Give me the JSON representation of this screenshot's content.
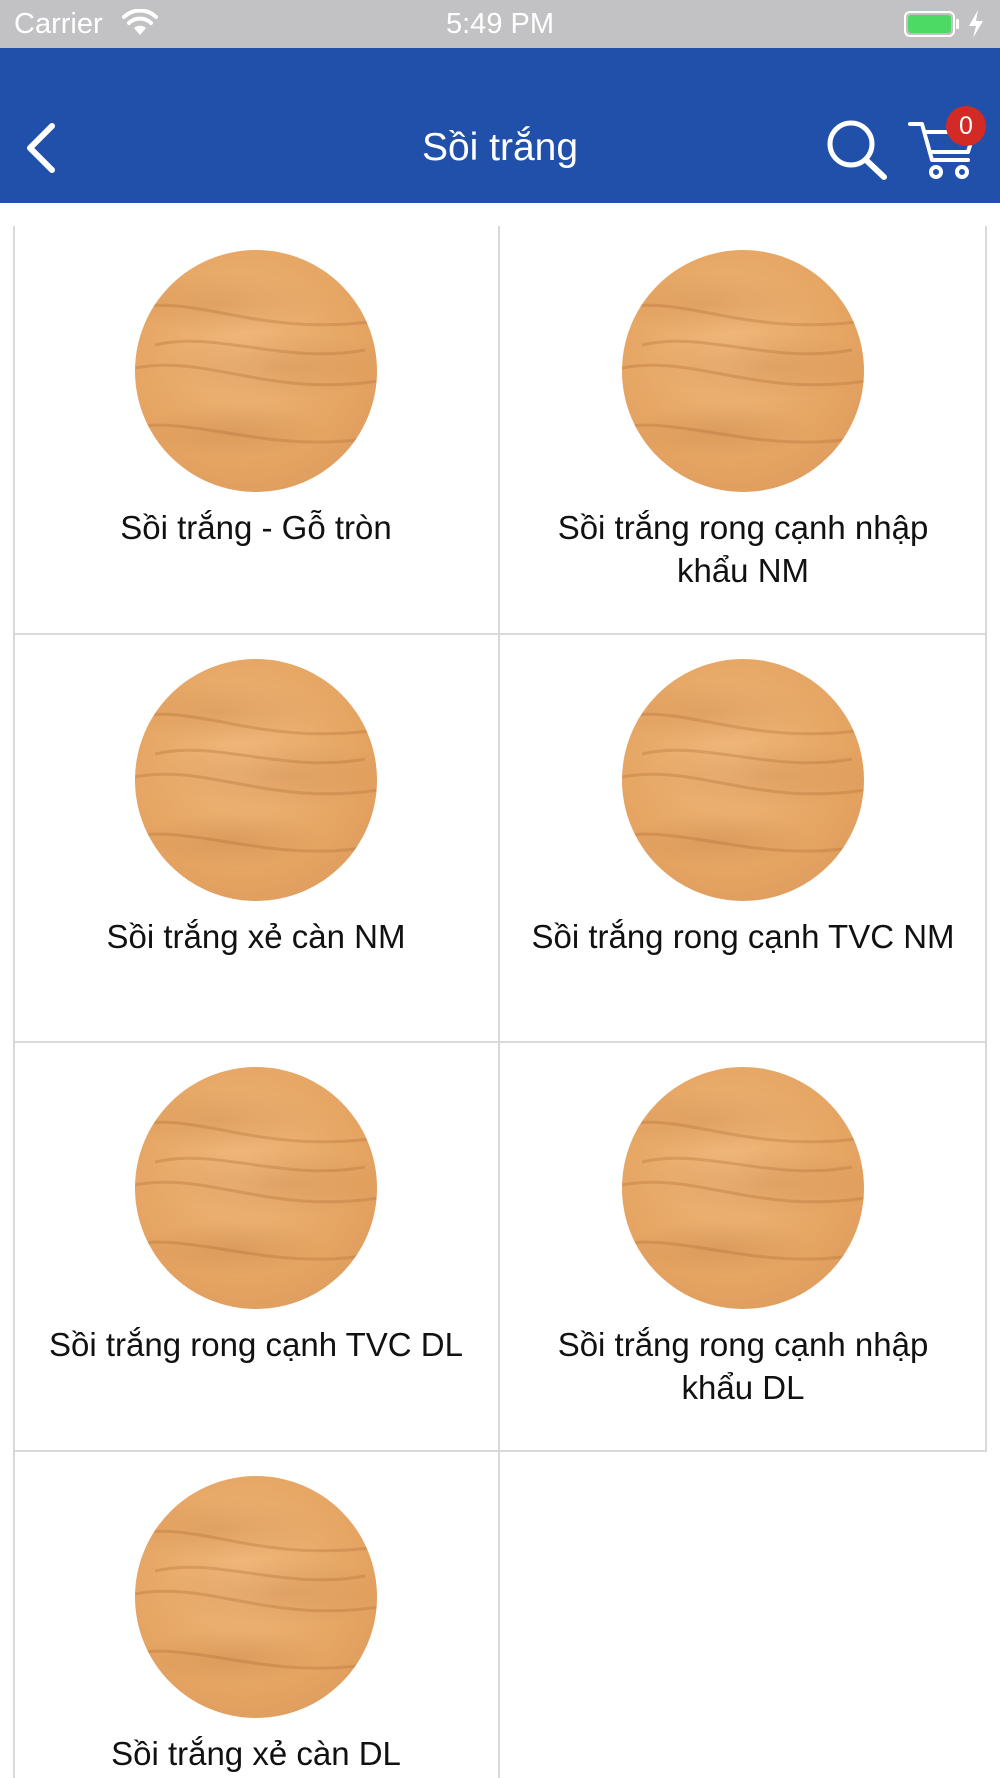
{
  "status_bar": {
    "carrier": "Carrier",
    "time": "5:49 PM",
    "battery_color": "#4cd964"
  },
  "nav": {
    "title": "Sồi trắng",
    "cart_count": "0",
    "background": "#2150aa",
    "badge_color": "#d42a26"
  },
  "products": [
    {
      "name": "Sồi trắng - Gỗ tròn"
    },
    {
      "name": "Sồi trắng rong cạnh nhập khẩu NM"
    },
    {
      "name": "Sồi trắng xẻ càn NM"
    },
    {
      "name": "Sồi trắng rong cạnh TVC NM"
    },
    {
      "name": "Sồi trắng rong cạnh TVC DL"
    },
    {
      "name": "Sồi trắng rong cạnh nhập khẩu DL"
    },
    {
      "name": "Sồi trắng xẻ càn DL"
    }
  ]
}
